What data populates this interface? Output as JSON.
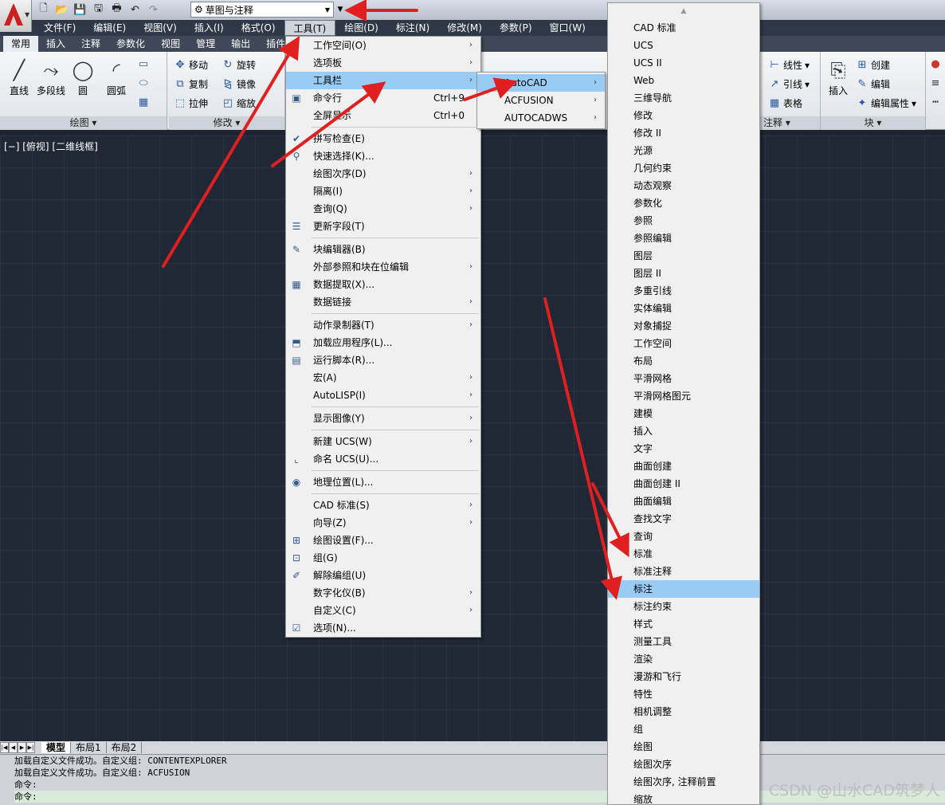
{
  "quick_access": {
    "icons": [
      "new-icon",
      "open-icon",
      "save-icon",
      "save-as-icon",
      "print-icon",
      "undo-icon",
      "redo-icon"
    ],
    "workspace": "草图与注释",
    "workspace_icon": "gear-icon"
  },
  "menubar": [
    "文件(F)",
    "编辑(E)",
    "视图(V)",
    "插入(I)",
    "格式(O)",
    "工具(T)",
    "绘图(D)",
    "标注(N)",
    "修改(M)",
    "参数(P)",
    "窗口(W)"
  ],
  "ribbon": {
    "tabs": [
      "常用",
      "插入",
      "注释",
      "参数化",
      "视图",
      "管理",
      "输出",
      "插件"
    ],
    "draw_panel": {
      "title": "绘图",
      "tools": [
        "直线",
        "多段线",
        "圆",
        "圆弧"
      ]
    },
    "modify_panel": {
      "title": "修改",
      "tools": [
        "移动",
        "旋转",
        "复制",
        "镜像",
        "拉伸",
        "缩放"
      ]
    },
    "annotation_panel": {
      "title": "注释",
      "tools": [
        "线性",
        "引线",
        "表格"
      ]
    },
    "block_panel": {
      "title": "块",
      "insert": "插入",
      "tools": [
        "创建",
        "编辑",
        "编辑属性"
      ]
    }
  },
  "viewport_label": "[−] [俯视] [二维线框]",
  "tools_menu": {
    "items": [
      {
        "label": "工作空间(O)",
        "sub": true
      },
      {
        "label": "选项板",
        "sub": true
      },
      {
        "label": "工具栏",
        "sub": true,
        "highlight": true
      },
      {
        "label": "命令行",
        "shortcut": "Ctrl+9",
        "icon": "command-line-icon"
      },
      {
        "label": "全屏显示",
        "shortcut": "Ctrl+0"
      },
      {
        "sep": true
      },
      {
        "label": "拼写检查(E)",
        "icon": "spell-check-icon"
      },
      {
        "label": "快速选择(K)...",
        "icon": "quick-select-icon"
      },
      {
        "label": "绘图次序(D)",
        "sub": true
      },
      {
        "label": "隔离(I)",
        "sub": true
      },
      {
        "label": "查询(Q)",
        "sub": true
      },
      {
        "label": "更新字段(T)",
        "icon": "update-field-icon"
      },
      {
        "sep": true
      },
      {
        "label": "块编辑器(B)",
        "icon": "block-editor-icon"
      },
      {
        "label": "外部参照和块在位编辑",
        "sub": true
      },
      {
        "label": "数据提取(X)...",
        "icon": "data-extraction-icon"
      },
      {
        "label": "数据链接",
        "sub": true
      },
      {
        "sep": true
      },
      {
        "label": "动作录制器(T)",
        "sub": true
      },
      {
        "label": "加载应用程序(L)...",
        "icon": "load-app-icon"
      },
      {
        "label": "运行脚本(R)...",
        "icon": "run-script-icon"
      },
      {
        "label": "宏(A)",
        "sub": true
      },
      {
        "label": "AutoLISP(I)",
        "sub": true
      },
      {
        "sep": true
      },
      {
        "label": "显示图像(Y)",
        "sub": true
      },
      {
        "sep": true
      },
      {
        "label": "新建 UCS(W)",
        "sub": true
      },
      {
        "label": "命名 UCS(U)...",
        "icon": "named-ucs-icon"
      },
      {
        "sep": true
      },
      {
        "label": "地理位置(L)...",
        "icon": "geolocation-icon"
      },
      {
        "sep": true
      },
      {
        "label": "CAD 标准(S)",
        "sub": true
      },
      {
        "label": "向导(Z)",
        "sub": true
      },
      {
        "label": "绘图设置(F)...",
        "icon": "drafting-settings-icon"
      },
      {
        "label": "组(G)",
        "icon": "group-icon"
      },
      {
        "label": "解除编组(U)",
        "icon": "ungroup-icon"
      },
      {
        "label": "数字化仪(B)",
        "sub": true
      },
      {
        "label": "自定义(C)",
        "sub": true
      },
      {
        "label": "选项(N)...",
        "icon": "options-check-icon"
      }
    ]
  },
  "toolbar_submenu": [
    {
      "label": "AutoCAD",
      "highlight": true
    },
    {
      "label": "ACFUSION"
    },
    {
      "label": "AUTOCADWS"
    }
  ],
  "autocad_toolbars": [
    "CAD 标准",
    "UCS",
    "UCS II",
    "Web",
    "三维导航",
    "修改",
    "修改 II",
    "光源",
    "几何约束",
    "动态观察",
    "参数化",
    "参照",
    "参照编辑",
    "图层",
    "图层 II",
    "多重引线",
    "实体编辑",
    "对象捕捉",
    "工作空间",
    "布局",
    "平滑网格",
    "平滑网格图元",
    "建模",
    "插入",
    "文字",
    "曲面创建",
    "曲面创建 II",
    "曲面编辑",
    "查找文字",
    "查询",
    "标准",
    "标准注释",
    "标注",
    "标注约束",
    "样式",
    "测量工具",
    "渲染",
    "漫游和飞行",
    "特性",
    "相机调整",
    "组",
    "绘图",
    "绘图次序",
    "绘图次序, 注释前置",
    "缩放"
  ],
  "autocad_highlight": "标注",
  "layout_tabs": [
    "模型",
    "布局1",
    "布局2"
  ],
  "command_lines": [
    "加载自定义文件成功。自定义组: CONTENTEXPLORER",
    "加载自定义文件成功。自定义组: ACFUSION",
    "命令:",
    "命令:"
  ],
  "watermark": "CSDN @山水CAD筑梦人",
  "colors": {
    "highlight": "#99ccf5",
    "arrow": "#e02020",
    "menubar": "#2f3846"
  }
}
